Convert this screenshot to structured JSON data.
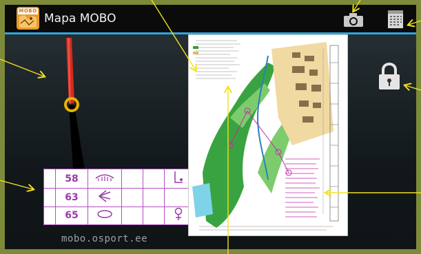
{
  "app": {
    "title": "Mapa MOBO",
    "icon_text": "MOBO"
  },
  "actionbar": {
    "icons": [
      "camera-icon",
      "calendar-icon"
    ]
  },
  "lock": {
    "icon": "lock-icon"
  },
  "control_card": {
    "rows": [
      {
        "code": "58",
        "symbol": "eye-shape"
      },
      {
        "code": "63",
        "symbol": "arrow-shape"
      },
      {
        "code": "65",
        "symbol": "oval-shape"
      }
    ]
  },
  "watermark": "mobo.osport.ee",
  "colors": {
    "accent_blue": "#2ea7df",
    "frame_olive": "#7d8a3a",
    "annotation_yellow": "#f2e21b",
    "compass_red": "#d42a1f",
    "card_purple": "#b94ac7"
  }
}
